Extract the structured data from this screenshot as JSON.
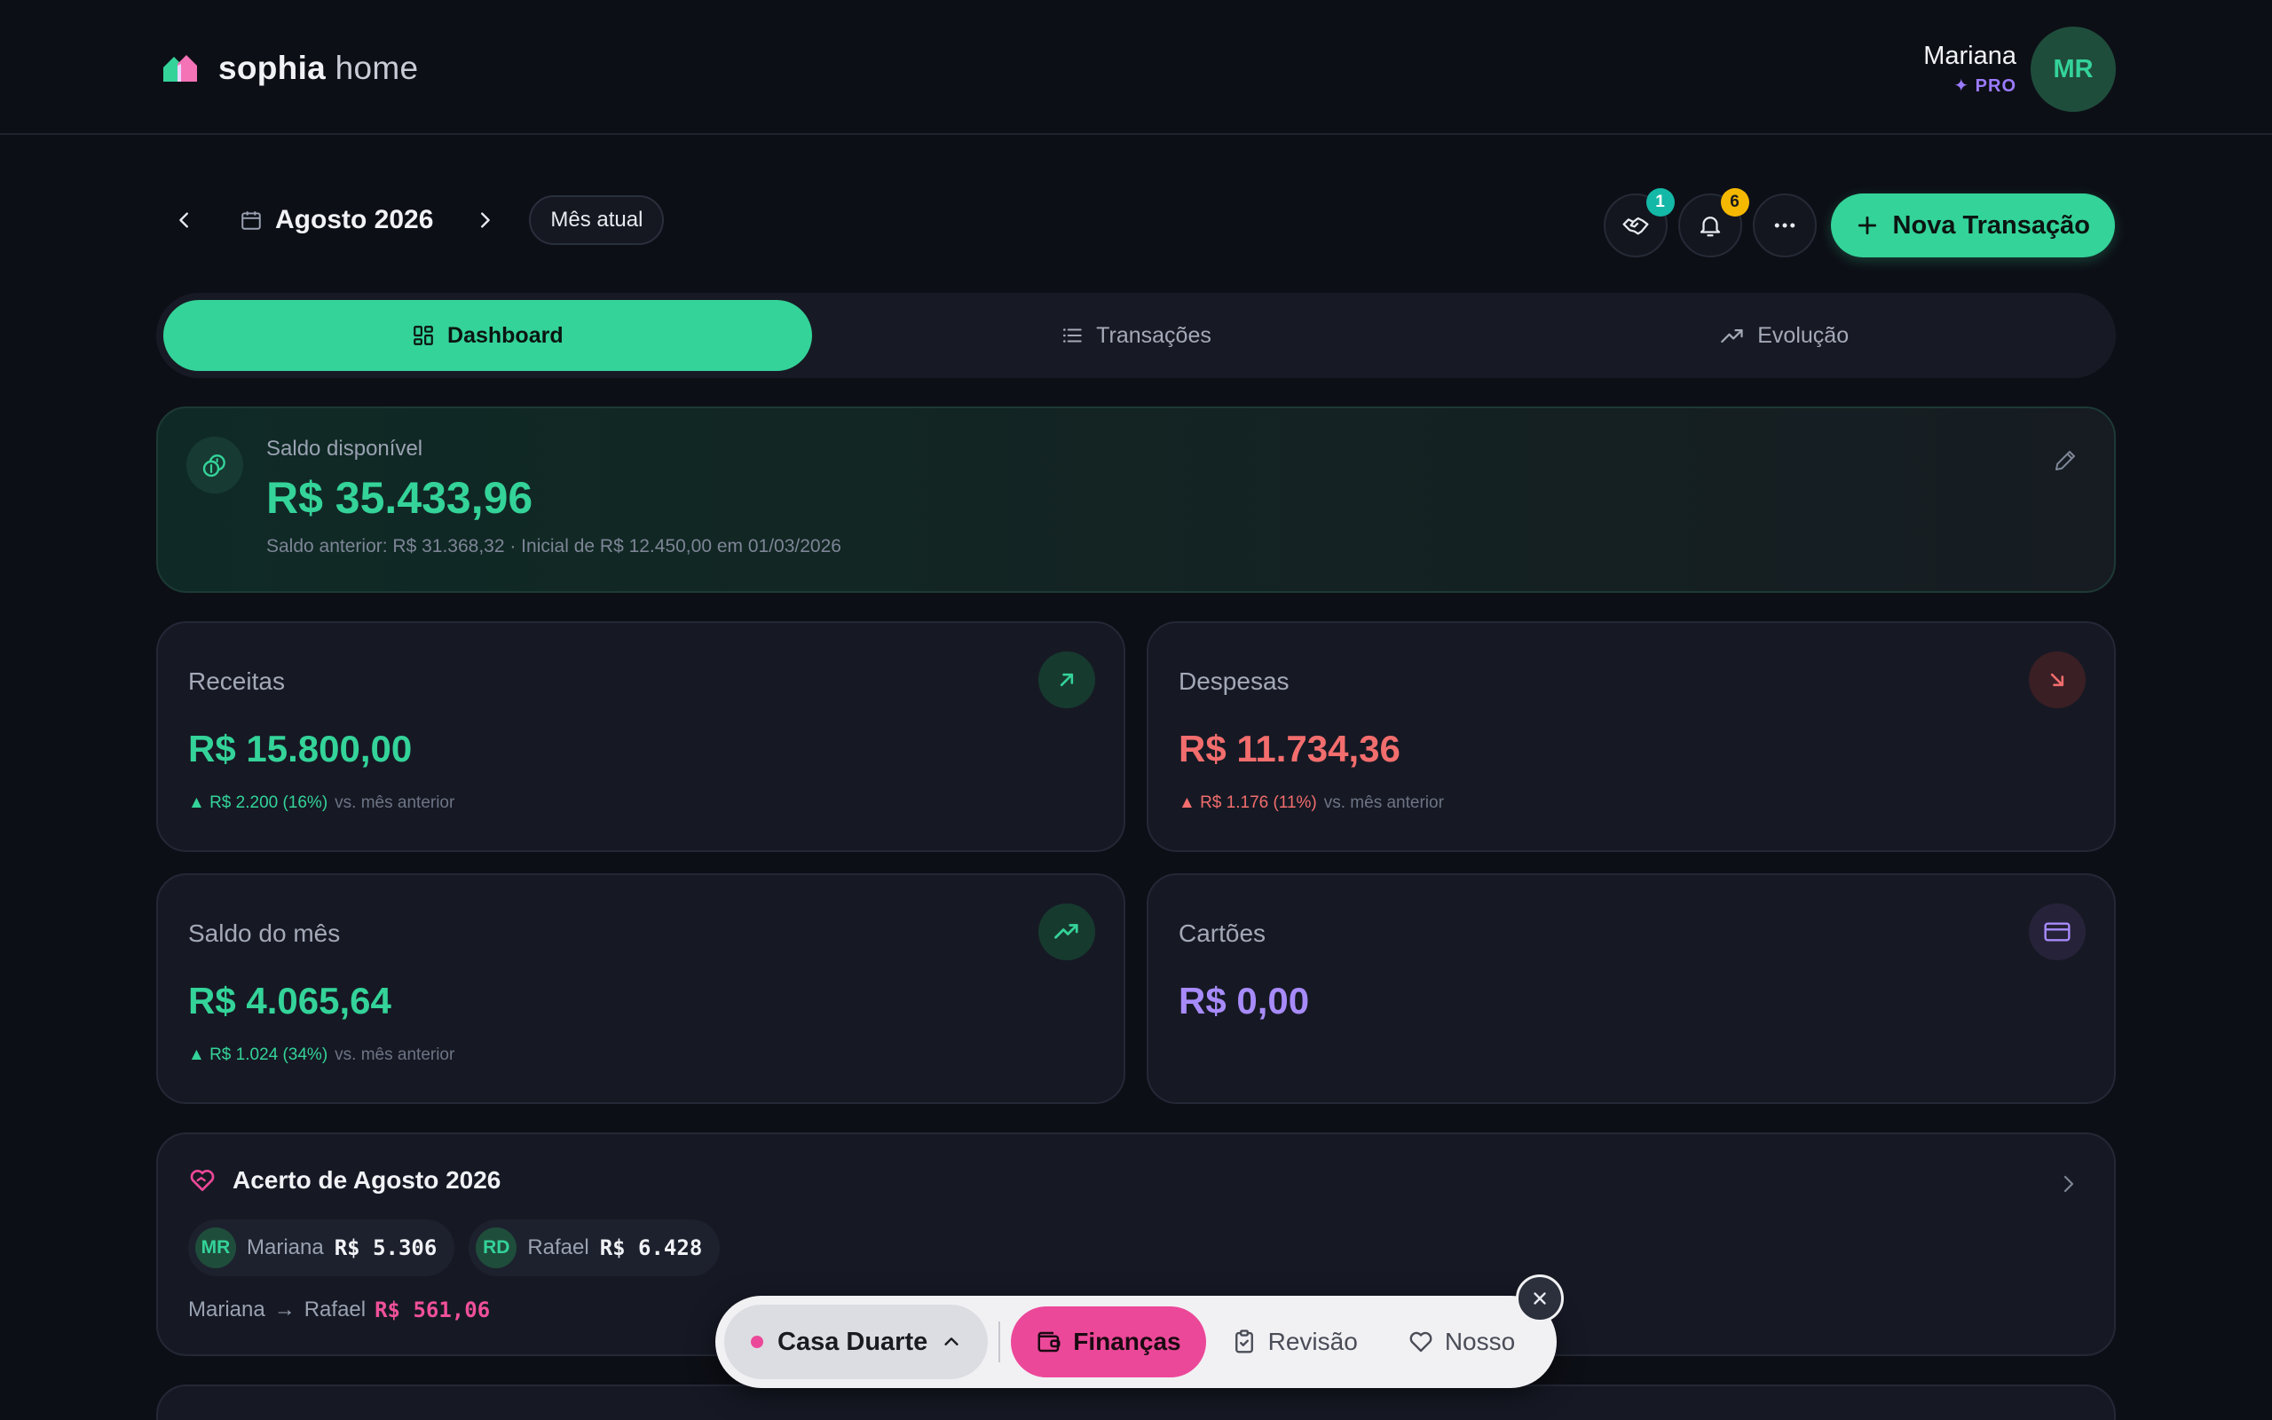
{
  "header": {
    "brand_bold": "sophia",
    "brand_light": "home",
    "user_name": "Mariana",
    "plan_badge": "✦ PRO",
    "avatar_initials": "MR"
  },
  "month_nav": {
    "month_label": "Agosto 2026",
    "current_month_button": "Mês atual"
  },
  "actions": {
    "handshake_badge": "1",
    "notifications_badge": "6",
    "new_transaction_label": "Nova Transação"
  },
  "tabs": [
    {
      "label": "Dashboard",
      "active": true,
      "icon": "grid-icon"
    },
    {
      "label": "Transações",
      "active": false,
      "icon": "list-icon"
    },
    {
      "label": "Evolução",
      "active": false,
      "icon": "trend-icon"
    }
  ],
  "balance": {
    "label": "Saldo disponível",
    "value": "R$ 35.433,96",
    "subtext": "Saldo anterior: R$ 31.368,32 · Inicial de R$ 12.450,00 em 01/03/2026"
  },
  "stats": {
    "income": {
      "label": "Receitas",
      "value": "R$ 15.800,00",
      "delta": "▲ R$ 2.200 (16%)",
      "vs": "vs. mês anterior"
    },
    "expenses": {
      "label": "Despesas",
      "value": "R$ 11.734,36",
      "delta": "▲ R$ 1.176 (11%)",
      "vs": "vs. mês anterior"
    },
    "month_balance": {
      "label": "Saldo do mês",
      "value": "R$ 4.065,64",
      "delta": "▲ R$ 1.024 (34%)",
      "vs": "vs. mês anterior"
    },
    "cards": {
      "label": "Cartões",
      "value": "R$ 0,00"
    }
  },
  "settlement": {
    "title": "Acerto de Agosto 2026",
    "people": [
      {
        "initials": "MR",
        "name": "Mariana",
        "amount": "R$ 5.306"
      },
      {
        "initials": "RD",
        "name": "Rafael",
        "amount": "R$ 6.428"
      }
    ],
    "from": "Mariana",
    "arrow": "→",
    "to": "Rafael",
    "amount": "R$ 561,06"
  },
  "dock": {
    "home_name": "Casa Duarte",
    "items": [
      {
        "label": "Finanças",
        "active": true
      },
      {
        "label": "Revisão",
        "active": false
      },
      {
        "label": "Nosso",
        "active": false
      }
    ]
  },
  "colors": {
    "accent": "#34d399",
    "expense": "#f26d6d",
    "cards": "#a78bfa",
    "pink": "#ec4899",
    "background": "#0d0f16"
  }
}
